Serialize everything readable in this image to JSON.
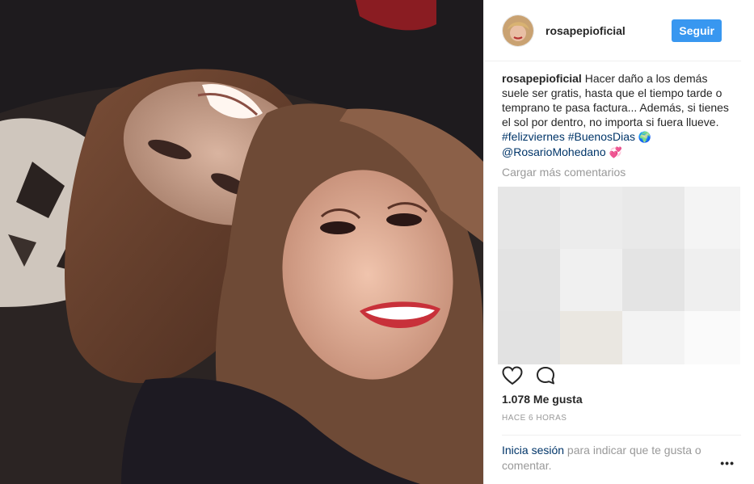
{
  "post": {
    "username": "rosapepioficial",
    "follow_label": "Seguir",
    "caption": {
      "user": "rosapepioficial",
      "text1": " Hacer daño a los demás suele ser gratis, hasta que el tiempo tarde o temprano te pasa factura... Además, si tienes el sol por dentro, no importa si fuera llueve. ",
      "hashtag1": "#felizviernes",
      "hashtag2": "#BuenosDias",
      "globe": "🌍",
      "mention": "@RosarioMohedano",
      "heart": "💞"
    },
    "load_more": "Cargar más comentarios",
    "likes": "1.078 Me gusta",
    "time": "HACE 6 HORAS",
    "login_link": "Inicia sesión",
    "login_text": " para indicar que te gusta o comentar.",
    "more_label": "•••"
  },
  "colors": {
    "follow": "#3897f0",
    "link": "#003569",
    "muted": "#999999"
  },
  "icons": [
    "heart-outline-icon",
    "comment-icon",
    "more-options-icon"
  ]
}
